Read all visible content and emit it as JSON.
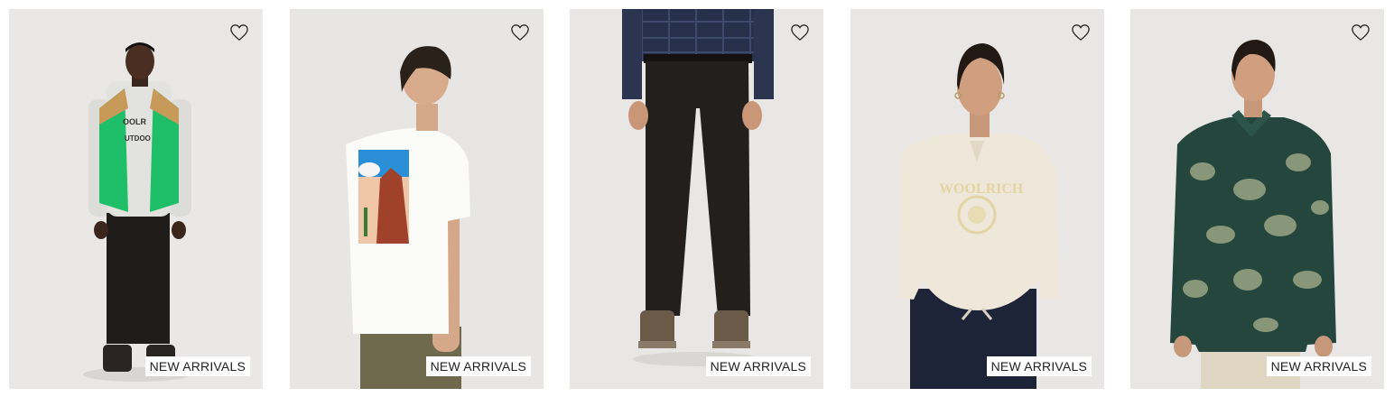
{
  "products": [
    {
      "badge": "NEW ARRIVALS",
      "wishlist_icon": "heart-outline-icon",
      "image_subject": "model-green-puffer-vest"
    },
    {
      "badge": "NEW ARRIVALS",
      "wishlist_icon": "heart-outline-icon",
      "image_subject": "model-white-tshirt-back-print"
    },
    {
      "badge": "NEW ARRIVALS",
      "wishlist_icon": "heart-outline-icon",
      "image_subject": "model-black-trousers"
    },
    {
      "badge": "NEW ARRIVALS",
      "wishlist_icon": "heart-outline-icon",
      "image_subject": "model-cream-sweatshirt"
    },
    {
      "badge": "NEW ARRIVALS",
      "wishlist_icon": "heart-outline-icon",
      "image_subject": "model-green-floral-overshirt"
    }
  ],
  "colors": {
    "card_background": "#e8e7e5",
    "badge_background": "#ffffff",
    "badge_text": "#222222"
  }
}
